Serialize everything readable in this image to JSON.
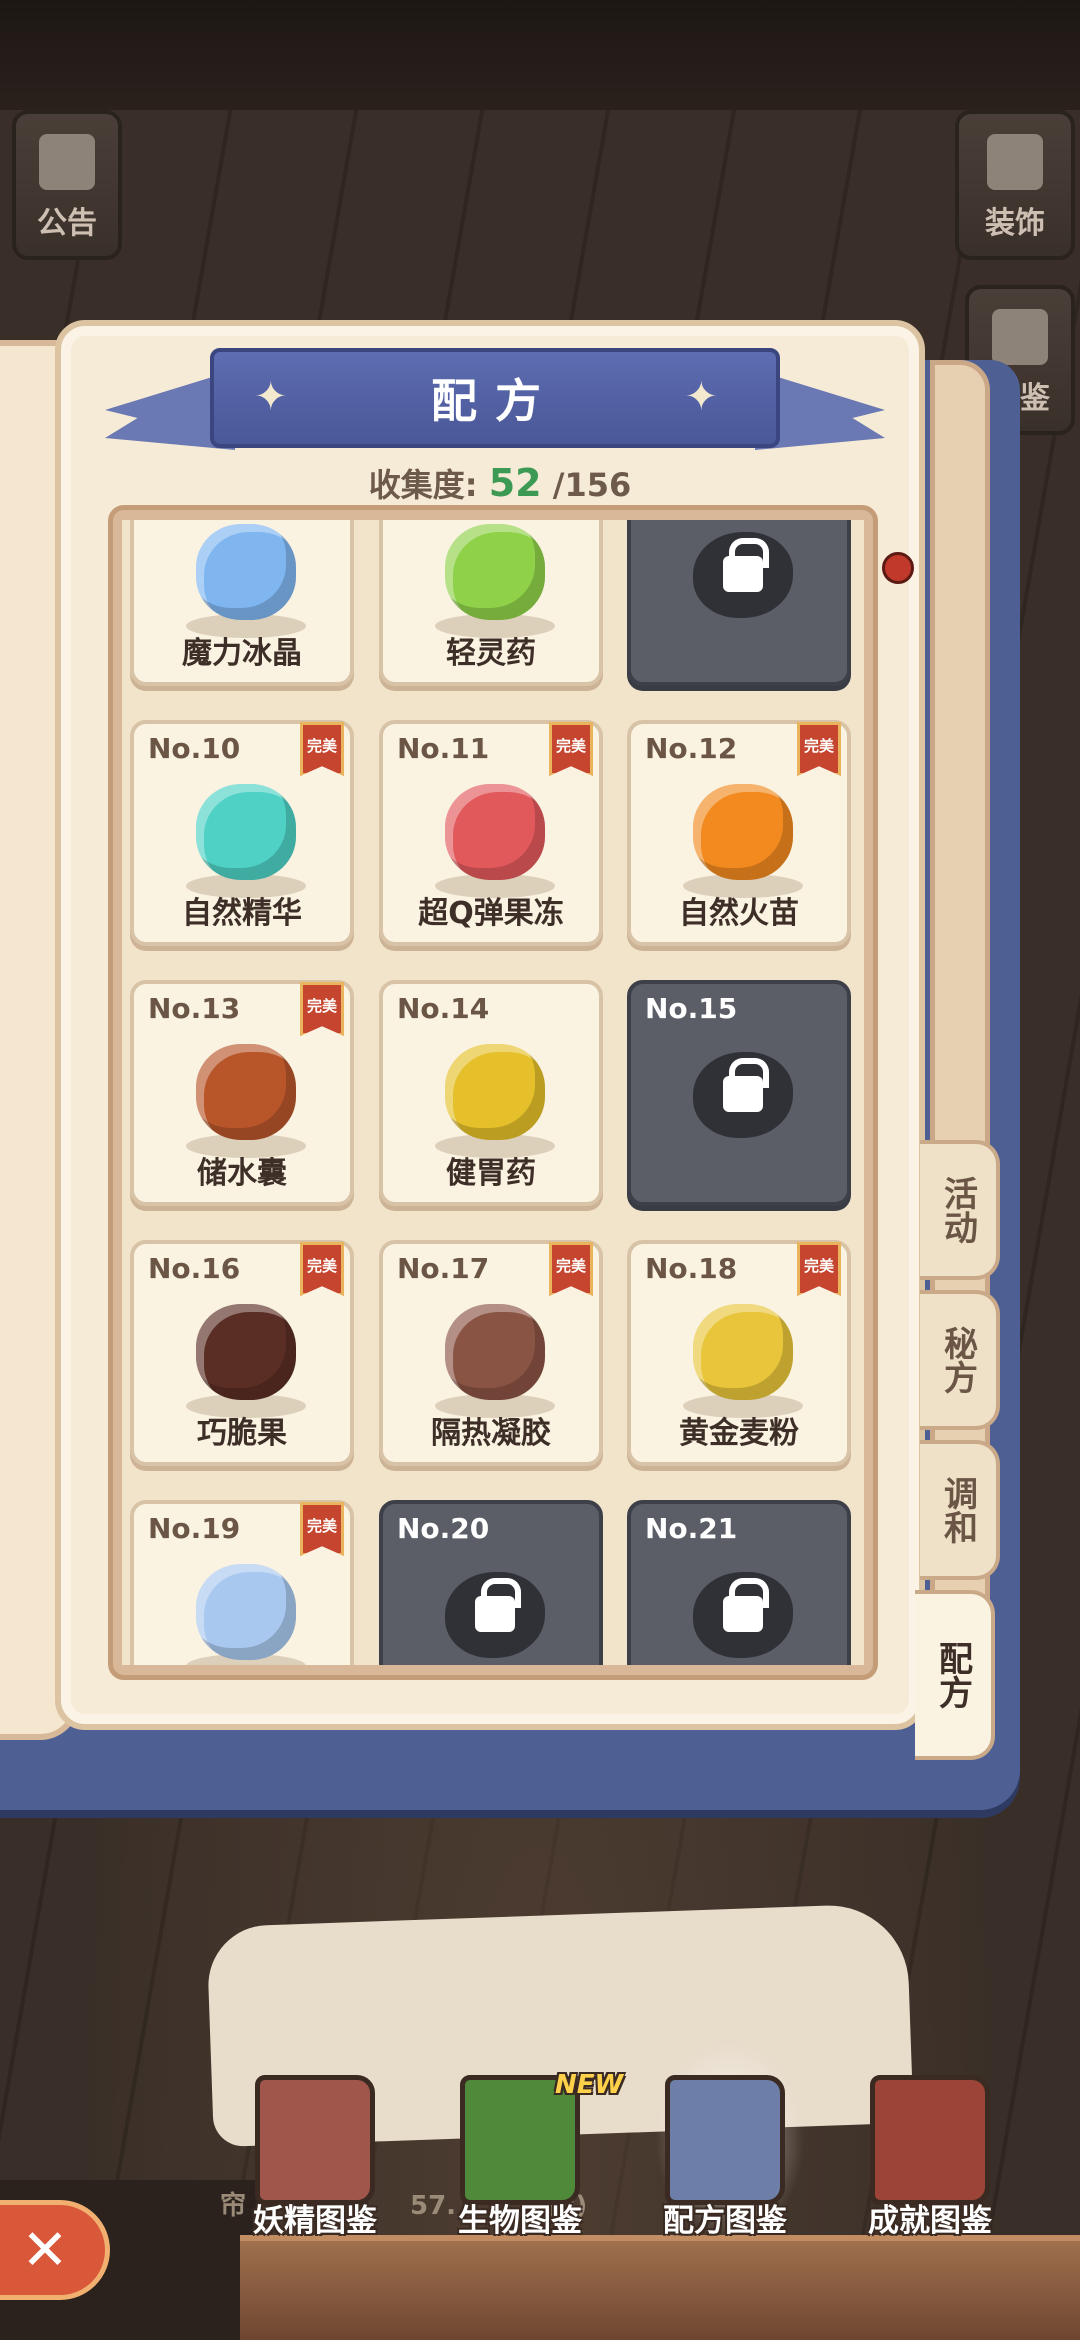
{
  "top_left_buttons": [
    {
      "label": "公告"
    }
  ],
  "top_right_buttons": [
    {
      "label": "装饰"
    },
    {
      "label": "图鉴"
    }
  ],
  "ribbon": {
    "title": "配方"
  },
  "collection": {
    "label": "收集度:",
    "current": "52",
    "total": "/156"
  },
  "cards": [
    {
      "no": "",
      "name": "魔力冰晶",
      "locked": false,
      "perfect": false,
      "icon": "ice-crystal-icon",
      "color": "#7fb6f0"
    },
    {
      "no": "",
      "name": "轻灵药",
      "locked": false,
      "perfect": false,
      "icon": "green-potion-bowl-icon",
      "color": "#8fd24a"
    },
    {
      "no": "",
      "name": "",
      "locked": true,
      "perfect": false,
      "icon": "lock-icon",
      "color": "#ffffff"
    },
    {
      "no": "No.10",
      "name": "自然精华",
      "locked": false,
      "perfect": true,
      "icon": "nature-essence-icon",
      "color": "#4fd1c5"
    },
    {
      "no": "No.11",
      "name": "超Q弹果冻",
      "locked": false,
      "perfect": true,
      "icon": "jelly-icon",
      "color": "#e2595c"
    },
    {
      "no": "No.12",
      "name": "自然火苗",
      "locked": false,
      "perfect": true,
      "icon": "flame-icon",
      "color": "#f28a1f"
    },
    {
      "no": "No.13",
      "name": "储水囊",
      "locked": false,
      "perfect": true,
      "icon": "water-pouch-icon",
      "color": "#b8562a"
    },
    {
      "no": "No.14",
      "name": "健胃药",
      "locked": false,
      "perfect": false,
      "icon": "yellow-potion-bowl-icon",
      "color": "#e5c02a"
    },
    {
      "no": "No.15",
      "name": "",
      "locked": true,
      "perfect": false,
      "icon": "lock-icon",
      "color": "#ffffff"
    },
    {
      "no": "No.16",
      "name": "巧脆果",
      "locked": false,
      "perfect": true,
      "icon": "chocolate-icon",
      "color": "#5a2e24"
    },
    {
      "no": "No.17",
      "name": "隔热凝胶",
      "locked": false,
      "perfect": true,
      "icon": "gel-cube-icon",
      "color": "#8a5444"
    },
    {
      "no": "No.18",
      "name": "黄金麦粉",
      "locked": false,
      "perfect": true,
      "icon": "golden-flour-icon",
      "color": "#e8c53a"
    },
    {
      "no": "No.19",
      "name": "",
      "locked": false,
      "perfect": true,
      "icon": "rain-cloud-icon",
      "color": "#a9c8ef"
    },
    {
      "no": "No.20",
      "name": "",
      "locked": true,
      "perfect": false,
      "icon": "lock-icon",
      "color": "#ffffff"
    },
    {
      "no": "No.21",
      "name": "",
      "locked": true,
      "perfect": false,
      "icon": "lock-icon",
      "color": "#ffffff"
    }
  ],
  "badge_text": "完美",
  "side_tabs": [
    {
      "label": "活动",
      "active": false
    },
    {
      "label": "秘方",
      "active": false
    },
    {
      "label": "调和",
      "active": false
    },
    {
      "label": "配方",
      "active": true
    }
  ],
  "bottom_nav": [
    {
      "label": "妖精图鉴",
      "color": "#a0564a",
      "icon": "fairy-book-icon"
    },
    {
      "label": "生物图鉴",
      "color": "#4e8a3a",
      "icon": "creature-book-icon",
      "new": "NEW"
    },
    {
      "label": "配方图鉴",
      "color": "#6d7fa8",
      "icon": "recipe-book-icon",
      "active": true
    },
    {
      "label": "成就图鉴",
      "color": "#9b4437",
      "icon": "achievement-book-icon"
    }
  ],
  "footer": {
    "left_text": "帘",
    "mid_text": "57.",
    "right_text": "(四)"
  },
  "close": {
    "symbol": "✕"
  }
}
